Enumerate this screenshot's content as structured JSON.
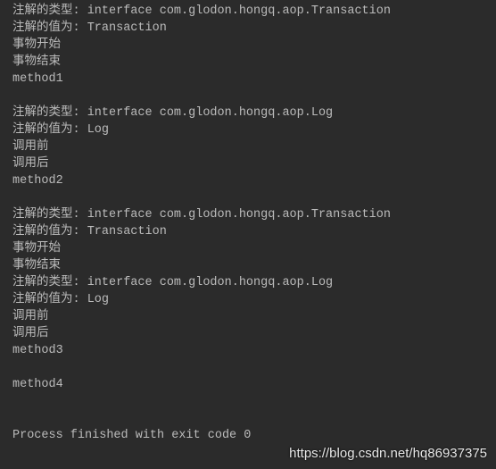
{
  "console": {
    "lines": [
      "注解的类型: interface com.glodon.hongq.aop.Transaction",
      "注解的值为: Transaction",
      "事物开始",
      "事物结束",
      "method1",
      "",
      "注解的类型: interface com.glodon.hongq.aop.Log",
      "注解的值为: Log",
      "调用前",
      "调用后",
      "method2",
      "",
      "注解的类型: interface com.glodon.hongq.aop.Transaction",
      "注解的值为: Transaction",
      "事物开始",
      "事物结束",
      "注解的类型: interface com.glodon.hongq.aop.Log",
      "注解的值为: Log",
      "调用前",
      "调用后",
      "method3",
      "",
      "method4",
      "",
      "",
      "Process finished with exit code 0"
    ]
  },
  "watermark": "https://blog.csdn.net/hq86937375",
  "colors": {
    "background": "#2b2b2b",
    "text": "#bbbbbb"
  }
}
